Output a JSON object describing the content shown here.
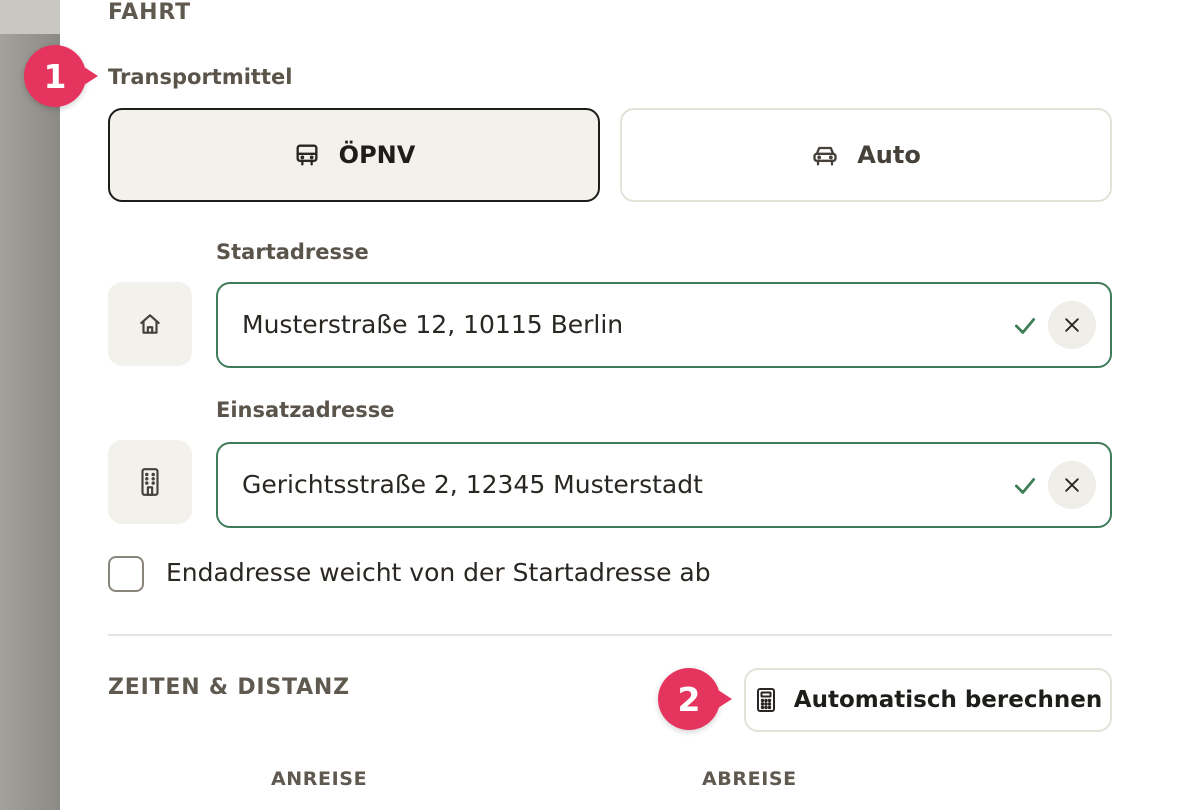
{
  "section_trip": {
    "title": "FAHRT"
  },
  "transport": {
    "label": "Transportmittel",
    "options": [
      {
        "label": "ÖPNV",
        "icon": "bus-icon",
        "selected": true
      },
      {
        "label": "Auto",
        "icon": "car-icon",
        "selected": false
      }
    ]
  },
  "start_address": {
    "label": "Startadresse",
    "value": "Musterstraße 12, 10115 Berlin",
    "icon": "home-icon",
    "valid": true
  },
  "work_address": {
    "label": "Einsatzadresse",
    "value": "Gerichtsstraße 2, 12345 Musterstadt",
    "icon": "building-icon",
    "valid": true
  },
  "end_address_checkbox": {
    "label": "Endadresse weicht von der Startadresse ab",
    "checked": false
  },
  "section_times": {
    "title": "ZEITEN & DISTANZ",
    "calculate_button": "Automatisch berechnen",
    "columns": [
      "ANREISE",
      "ABREISE"
    ]
  },
  "markers": [
    "1",
    "2"
  ],
  "colors": {
    "accent_valid": "#3f7d58",
    "marker": "#e5355e",
    "selected_bg": "#f2f1ec"
  }
}
